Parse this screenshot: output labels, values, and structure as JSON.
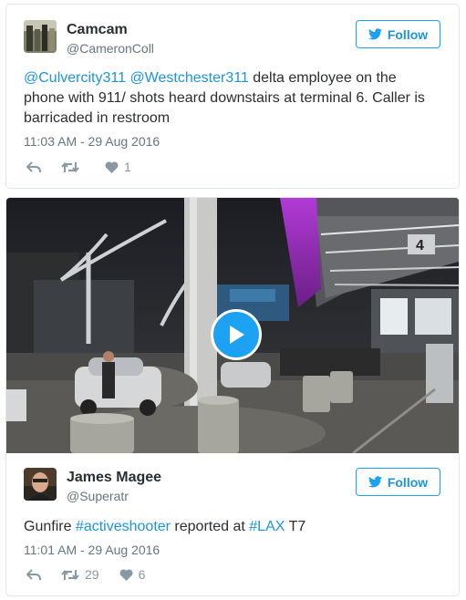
{
  "tweet1": {
    "name": "Camcam",
    "handle": "@CameronColl",
    "follow_label": "Follow",
    "mention1": "@Culvercity311",
    "mention2": "@Westchester311",
    "text_rest": " delta employee on the phone with 911/ shots heard downstairs at terminal 6. Caller is barricaded in restroom",
    "timestamp": "11:03 AM - 29 Aug 2016",
    "retweets": "",
    "likes": "1"
  },
  "tweet2": {
    "name": "James Magee",
    "handle": "@Superatr",
    "follow_label": "Follow",
    "text_start": "Gunfire ",
    "hashtag1": "#activeshooter",
    "text_mid": " reported at ",
    "hashtag2": "#LAX",
    "text_end": " T7",
    "timestamp": "11:01 AM - 29 Aug 2016",
    "retweets": "29",
    "likes": "6",
    "video_sign": "4"
  },
  "colors": {
    "link": "#1b95e0",
    "muted": "#66757f",
    "accent": "#1da1f2"
  },
  "icons": [
    "twitter-bird-icon",
    "reply-icon",
    "retweet-icon",
    "heart-icon",
    "play-icon"
  ]
}
